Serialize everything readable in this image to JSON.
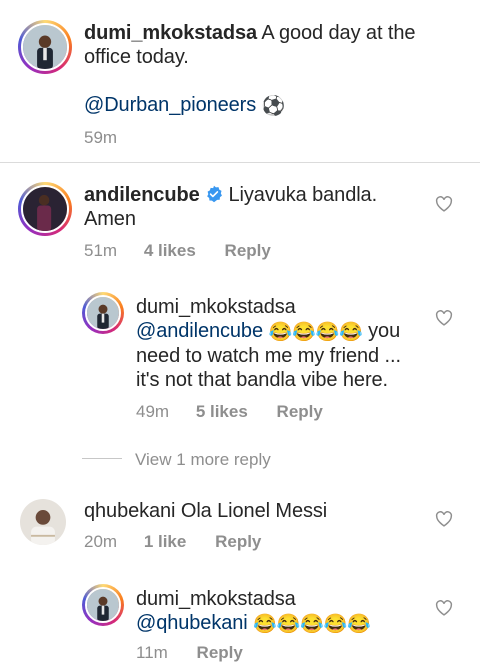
{
  "caption": {
    "username": "dumi_mkokstadsa",
    "text_line1": "A good day at the",
    "text_line2": "office today.",
    "mention": "@Durban_pioneers",
    "mention_emoji": "⚽",
    "time": "59m"
  },
  "comments": [
    {
      "username": "andilencube",
      "verified": true,
      "text_line1": "Liyavuka bandla.",
      "text_line2": "Amen",
      "time": "51m",
      "likes": "4 likes",
      "reply": "Reply"
    },
    {
      "username": "dumi_mkokstadsa",
      "mention": "@andilencube",
      "emojis": "😂😂😂😂",
      "text_line1_end": "you",
      "text_line2": "need to watch me my friend ...",
      "text_line3": "it's not that bandla vibe here.",
      "time": "49m",
      "likes": "5 likes",
      "reply": "Reply"
    },
    {
      "view_more": "View 1 more reply"
    },
    {
      "username": "qhubekani",
      "text": "Ola Lionel Messi",
      "time": "20m",
      "likes": "1 like",
      "reply": "Reply"
    },
    {
      "username": "dumi_mkokstadsa",
      "mention": "@qhubekani",
      "emojis": "😂😂😂😂😂",
      "time": "11m",
      "reply": "Reply"
    }
  ],
  "colors": {
    "text": "#262626",
    "secondary": "#8e8e8e",
    "mention": "#003569",
    "verified": "#3897f0"
  }
}
